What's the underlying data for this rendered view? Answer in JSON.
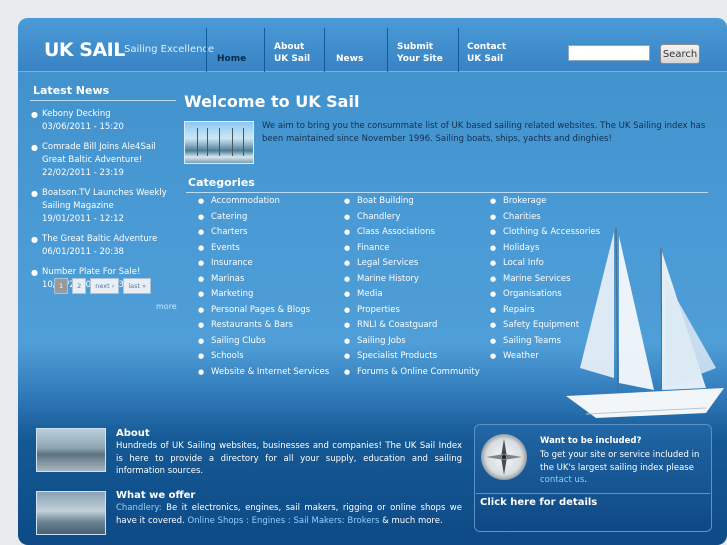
{
  "header": {
    "logo": "UK SAIL",
    "tagline": "Sailing Excellence",
    "nav": [
      {
        "line1": "Home",
        "line2": ""
      },
      {
        "line1": "About",
        "line2": "UK Sail"
      },
      {
        "line1": "News",
        "line2": ""
      },
      {
        "line1": "Submit",
        "line2": "Your Site"
      },
      {
        "line1": "Contact",
        "line2": "UK Sail"
      }
    ],
    "search_value": "",
    "search_button": "Search"
  },
  "news": {
    "title": "Latest News",
    "items": [
      {
        "title": "Kebony Decking",
        "date": "03/06/2011 - 15:20"
      },
      {
        "title": "Comrade Bill Joins Ale4Sail Great Baltic Adventure!",
        "date": "22/02/2011 - 23:19"
      },
      {
        "title": "Boatson.TV Launches Weekly Sailing Magazine",
        "date": "19/01/2011 - 12:12"
      },
      {
        "title": "The Great Baltic Adventure",
        "date": "06/01/2011 - 20:38"
      },
      {
        "title": "Number Plate For Sale!",
        "date": "10/12/2010 - 22:33"
      }
    ],
    "pager": [
      "1",
      "2",
      "next ›",
      "last »"
    ],
    "more": "more"
  },
  "welcome": {
    "title": "Welcome to UK Sail",
    "text": "We aim to bring you the consummate list of UK based sailing related websites. The UK Sailing index has been maintained since November 1996. Sailing boats, ships, yachts and dinghies!"
  },
  "categories": {
    "title": "Categories",
    "col1": [
      "Accommodation",
      "Catering",
      "Charters",
      "Events",
      "Insurance",
      "Marinas",
      "Marketing",
      "Personal Pages & Blogs",
      "Restaurants & Bars",
      "Sailing Clubs",
      "Schools",
      "Website & Internet Services"
    ],
    "col2": [
      "Boat Building",
      "Chandlery",
      "Class Associations",
      "Finance",
      "Legal Services",
      "Marine History",
      "Media",
      "Properties",
      "RNLI & Coastguard",
      "Sailing Jobs",
      "Specialist Products",
      "Forums & Online Community"
    ],
    "col3": [
      "Brokerage",
      "Charities",
      "Clothing & Accessories",
      "Holidays",
      "Local Info",
      "Marine Services",
      "Organisations",
      "Repairs",
      "Safety Equipment",
      "Sailing Teams",
      "Weather"
    ]
  },
  "about": {
    "title": "About",
    "text": "Hundreds of UK Sailing websites, businesses and companies! The UK Sail Index is here to provide a directory for all your supply, education and sailing information sources."
  },
  "offer": {
    "title": "What we offer",
    "part1_hl": "Chandlery:",
    "part1": " Be it electronics, engines, sail makers, rigging or online shops we have it covered. ",
    "part2_hl": "Online Shops : Engines : Sail Makers: Brokers",
    "part2": " & much more."
  },
  "included": {
    "title": "Want to be included?",
    "text": "To get your site or service included in the UK's largest sailing index please ",
    "link": "contact us",
    "end": ".",
    "details": "Click here for details"
  },
  "colors": {
    "accent": "#4a9ad6",
    "dark_blue": "#0d4a86",
    "link": "#8fd0ff"
  }
}
